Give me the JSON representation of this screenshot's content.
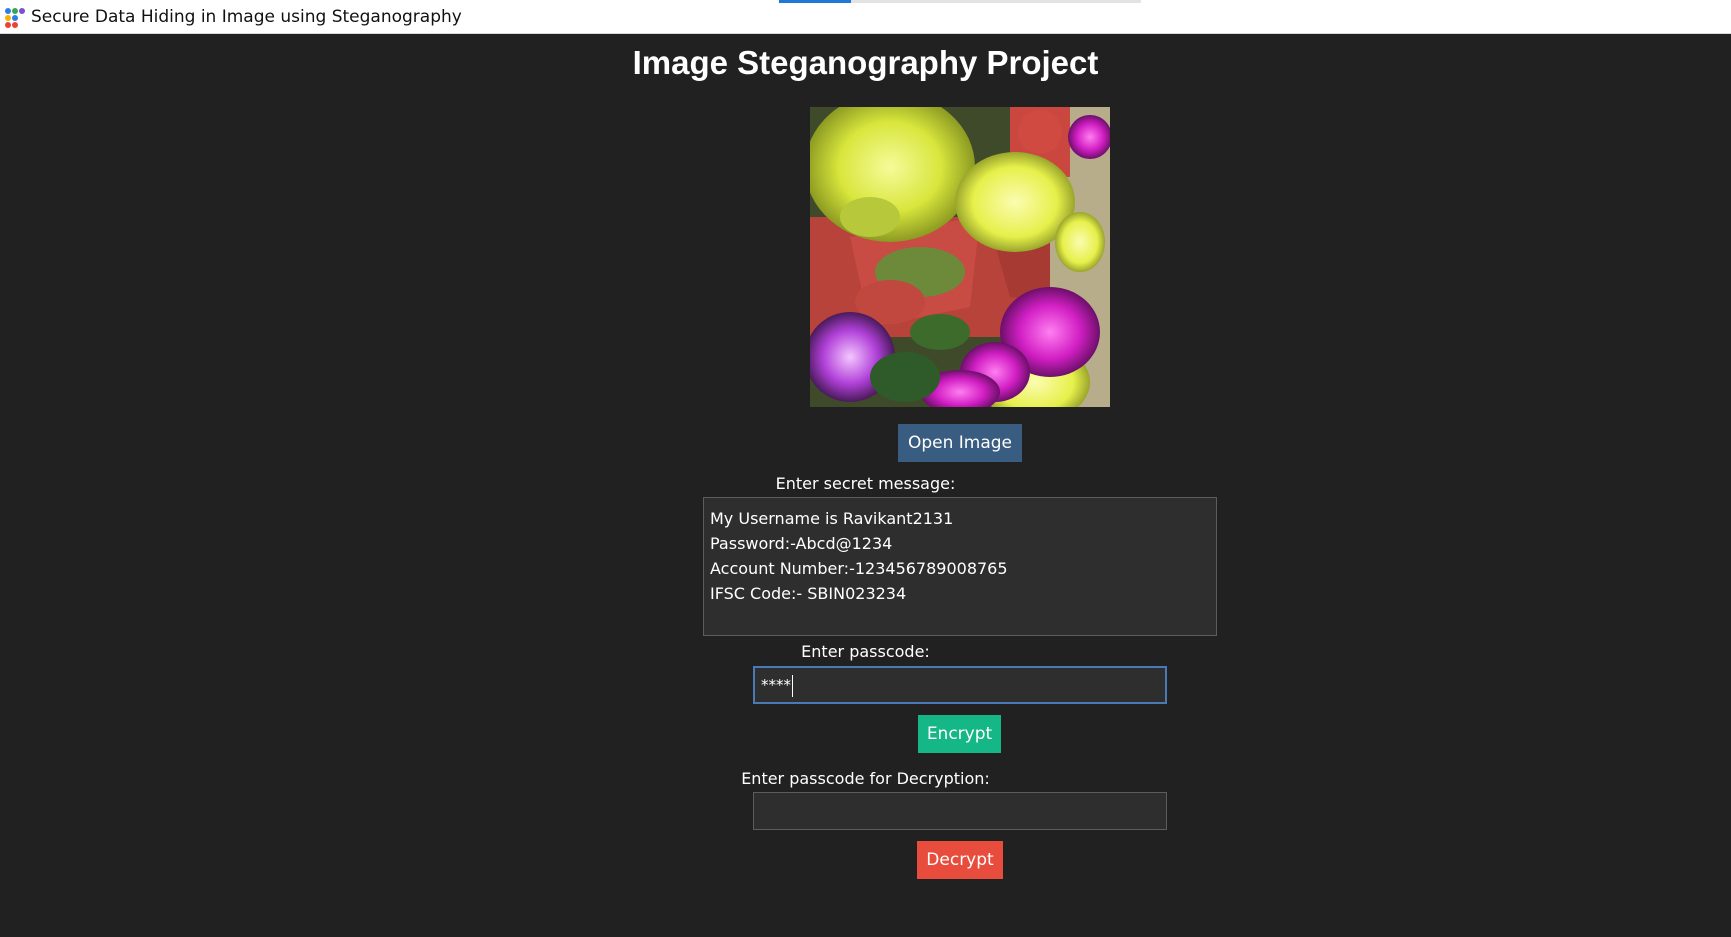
{
  "window": {
    "title": "Secure Data Hiding in Image using Steganography",
    "app_icon": "app-dots-icon",
    "loading_progress": 0.2
  },
  "page": {
    "heading": "Image Steganography Project"
  },
  "image": {
    "description_icon": "flowers-photo"
  },
  "buttons": {
    "open_image": "Open Image",
    "encrypt": "Encrypt",
    "decrypt": "Decrypt"
  },
  "labels": {
    "secret_message": "Enter secret message:",
    "passcode": "Enter passcode:",
    "decrypt_passcode": "Enter passcode for Decryption:"
  },
  "secret_message": {
    "lines": [
      "My Username is Ravikant2131",
      "Password:-Abcd@1234",
      "Account Number:-123456789008765",
      "IFSC Code:- SBIN023234"
    ]
  },
  "passcode": {
    "value": "****"
  },
  "decrypt_passcode": {
    "value": ""
  },
  "colors": {
    "background": "#212121",
    "open_button": "#385d80",
    "encrypt_button": "#14b785",
    "decrypt_button": "#e74c3c",
    "focus_border": "#4a7ab5"
  }
}
